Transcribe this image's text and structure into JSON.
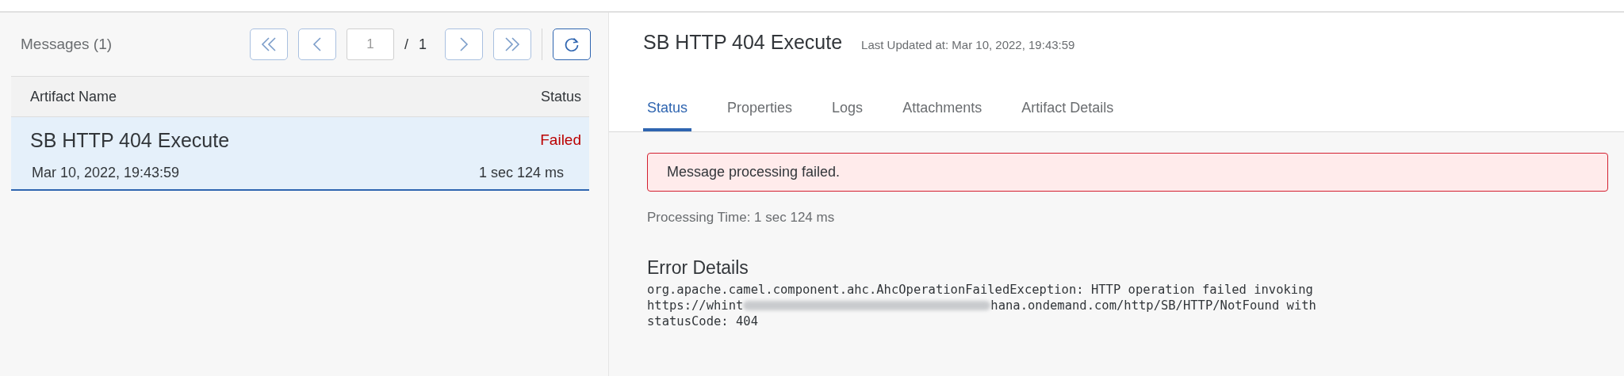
{
  "list_panel": {
    "title": "Messages (1)",
    "pager": {
      "page": "1",
      "separator": "/",
      "total": "1"
    },
    "columns": [
      "Artifact Name",
      "Status"
    ],
    "rows": [
      {
        "name": "SB HTTP 404 Execute",
        "status": "Failed",
        "kind": "error",
        "date": "Mar 10, 2022, 19:43:59",
        "duration": "1 sec 124 ms",
        "selected": true
      }
    ]
  },
  "detail": {
    "title": "SB HTTP 404 Execute",
    "last_updated": "Last Updated at: Mar 10, 2022, 19:43:59",
    "tabs": [
      {
        "label": "Status",
        "selected": true
      },
      {
        "label": "Properties",
        "selected": false
      },
      {
        "label": "Logs",
        "selected": false
      },
      {
        "label": "Attachments",
        "selected": false
      },
      {
        "label": "Artifact Details",
        "selected": false
      }
    ],
    "alert": {
      "kind": "error",
      "text": "Message processing failed."
    },
    "processing_time": "Processing Time: 1 sec 124 ms",
    "error_heading": "Error Details",
    "error_lines": [
      {
        "text": "org.apache.camel.component.ahc.AhcOperationFailedException: HTTP operation failed invoking"
      },
      {
        "text": "https://whint",
        "redacted": true,
        "after": "hana.ondemand.com/http/SB/HTTP/NotFound with"
      },
      {
        "text": "statusCode: 404"
      }
    ]
  }
}
